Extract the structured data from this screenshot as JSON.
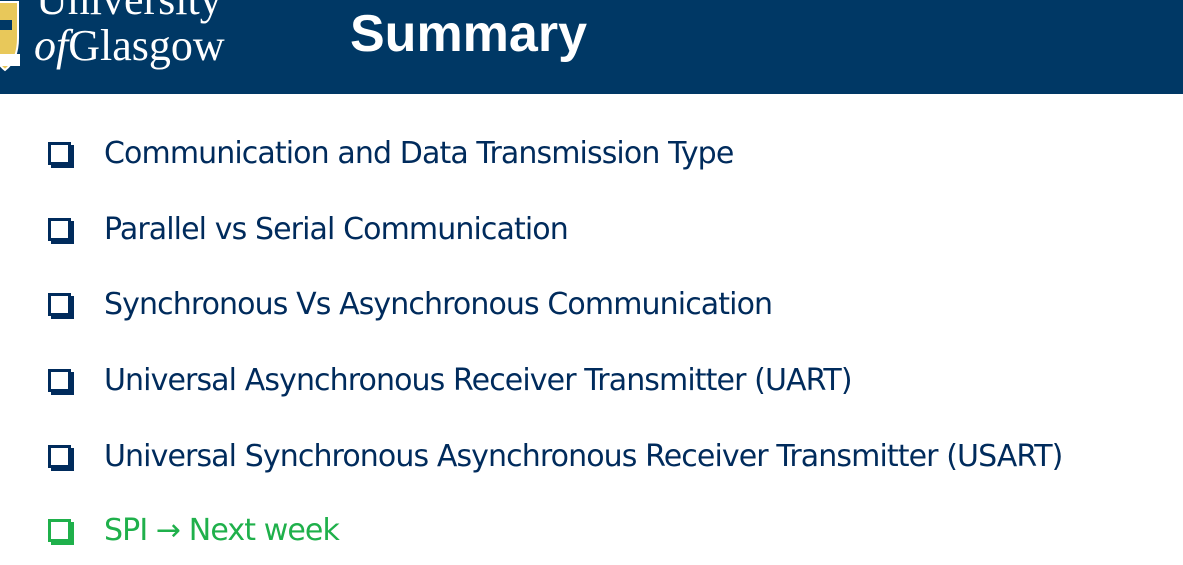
{
  "header": {
    "logo_line1": "University",
    "logo_of": "of",
    "logo_line2": "Glasgow",
    "title": "Summary",
    "background_color": "#003865"
  },
  "items": [
    {
      "label": "Communication and Data Transmission Type",
      "color": "#002b5c",
      "icon": "checkbox-icon"
    },
    {
      "label": "Parallel vs Serial Communication",
      "color": "#002b5c",
      "icon": "checkbox-icon"
    },
    {
      "label": "Synchronous Vs Asynchronous Communication",
      "color": "#002b5c",
      "icon": "checkbox-icon"
    },
    {
      "label": "Universal Asynchronous Receiver Transmitter (UART)",
      "color": "#002b5c",
      "icon": "checkbox-icon"
    },
    {
      "label": "Universal Synchronous Asynchronous Receiver Transmitter (USART)",
      "color": "#002b5c",
      "icon": "checkbox-icon"
    },
    {
      "label": "SPI → Next week",
      "color": "#1fb04b",
      "icon": "checkbox-icon"
    }
  ]
}
